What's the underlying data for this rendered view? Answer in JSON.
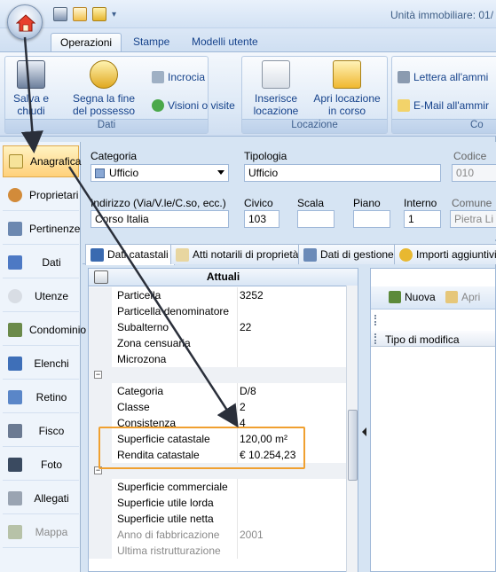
{
  "titlebar": {
    "title": "Unità immobiliare: 01/"
  },
  "ribbon": {
    "tabs": [
      {
        "label": "Operazioni",
        "active": true
      },
      {
        "label": "Stampe"
      },
      {
        "label": "Modelli utente"
      }
    ],
    "groups": {
      "dati": {
        "label": "Dati",
        "save": "Salva e chiudi",
        "end_possession": "Segna la fine del possesso",
        "incrocia": "Incrocia",
        "visioni": "Visioni o visite"
      },
      "locazione": {
        "label": "Locazione",
        "insert": "Inserisce locazione",
        "open": "Apri locazione in corso"
      },
      "com": {
        "label": "Co",
        "letter": "Lettera all'ammi",
        "email": "E-Mail all'ammir"
      }
    }
  },
  "nav": {
    "items": [
      {
        "label": "Anagrafica",
        "active": true
      },
      {
        "label": "Proprietari"
      },
      {
        "label": "Pertinenze"
      },
      {
        "label": "Dati"
      },
      {
        "label": "Utenze"
      },
      {
        "label": "Condominio"
      },
      {
        "label": "Elenchi"
      },
      {
        "label": "Retino"
      },
      {
        "label": "Fisco"
      },
      {
        "label": "Foto"
      },
      {
        "label": "Allegati"
      },
      {
        "label": "Mappa",
        "disabled": true
      }
    ]
  },
  "form": {
    "categoria": {
      "label": "Categoria",
      "value": "Ufficio"
    },
    "tipologia": {
      "label": "Tipologia",
      "value": "Ufficio"
    },
    "codice": {
      "label": "Codice",
      "value": "010"
    },
    "indirizzo": {
      "label": "Indirizzo (Via/V.le/C.so, ecc.)",
      "value": "Corso Italia"
    },
    "civico": {
      "label": "Civico",
      "value": "103"
    },
    "scala": {
      "label": "Scala",
      "value": ""
    },
    "piano": {
      "label": "Piano",
      "value": ""
    },
    "interno": {
      "label": "Interno",
      "value": "1"
    },
    "comune": {
      "label": "Comune",
      "value": "Pietra Li"
    }
  },
  "content_tabs": [
    {
      "label": "Dati catastali",
      "active": true
    },
    {
      "label": "Atti notarili di proprietà"
    },
    {
      "label": "Dati di gestione"
    },
    {
      "label": "Importi aggiuntivi"
    }
  ],
  "grid": {
    "header": "Attuali",
    "rows": [
      {
        "name": "Particella",
        "value": "3252"
      },
      {
        "name": "Particella denominatore",
        "value": ""
      },
      {
        "name": "Subalterno",
        "value": "22"
      },
      {
        "name": "Zona censuaria",
        "value": ""
      },
      {
        "name": "Microzona",
        "value": ""
      },
      {
        "category": true
      },
      {
        "name": "Categoria",
        "value": "D/8"
      },
      {
        "name": "Classe",
        "value": "2"
      },
      {
        "name": "Consistenza",
        "value": "4"
      },
      {
        "name": "Superficie catastale",
        "value": "120,00 m²"
      },
      {
        "name": "Rendita catastale",
        "value": "€ 10.254,23"
      },
      {
        "category": true
      },
      {
        "name": "Superficie commerciale",
        "value": ""
      },
      {
        "name": "Superficie utile lorda",
        "value": ""
      },
      {
        "name": "Superficie utile netta",
        "value": ""
      },
      {
        "name": "Anno di fabbricazione",
        "value": "2001",
        "disabled": true
      },
      {
        "name": "Ultima ristrutturazione",
        "value": "",
        "disabled": true
      }
    ]
  },
  "right_panel": {
    "new": "Nuova",
    "open": "Apri",
    "column": "Tipo di modifica"
  }
}
